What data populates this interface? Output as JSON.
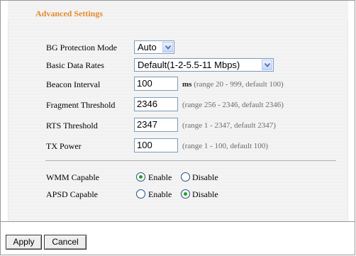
{
  "section_title": "Advanced Settings",
  "fields": {
    "bg_protection": {
      "label": "BG Protection Mode",
      "value": "Auto"
    },
    "basic_rates": {
      "label": "Basic Data Rates",
      "value": "Default(1-2-5.5-11 Mbps)"
    },
    "beacon": {
      "label": "Beacon Interval",
      "value": "100",
      "unit": "ms",
      "hint": "(range 20 - 999, default 100)"
    },
    "fragment": {
      "label": "Fragment Threshold",
      "value": "2346",
      "hint": "(range 256 - 2346, default 2346)"
    },
    "rts": {
      "label": "RTS Threshold",
      "value": "2347",
      "hint": "(range 1 - 2347, default 2347)"
    },
    "tx_power": {
      "label": "TX Power",
      "value": "100",
      "hint": "(range 1 - 100, default 100)"
    }
  },
  "wmm": {
    "label": "WMM Capable",
    "enable": "Enable",
    "disable": "Disable",
    "selected": "Enable"
  },
  "apsd": {
    "label": "APSD Capable",
    "enable": "Enable",
    "disable": "Disable",
    "selected": "Disable"
  },
  "buttons": {
    "apply": "Apply",
    "cancel": "Cancel"
  },
  "colors": {
    "title": "#e68a2e",
    "radio_dot": "#21a121",
    "field_border": "#7f9db9"
  }
}
